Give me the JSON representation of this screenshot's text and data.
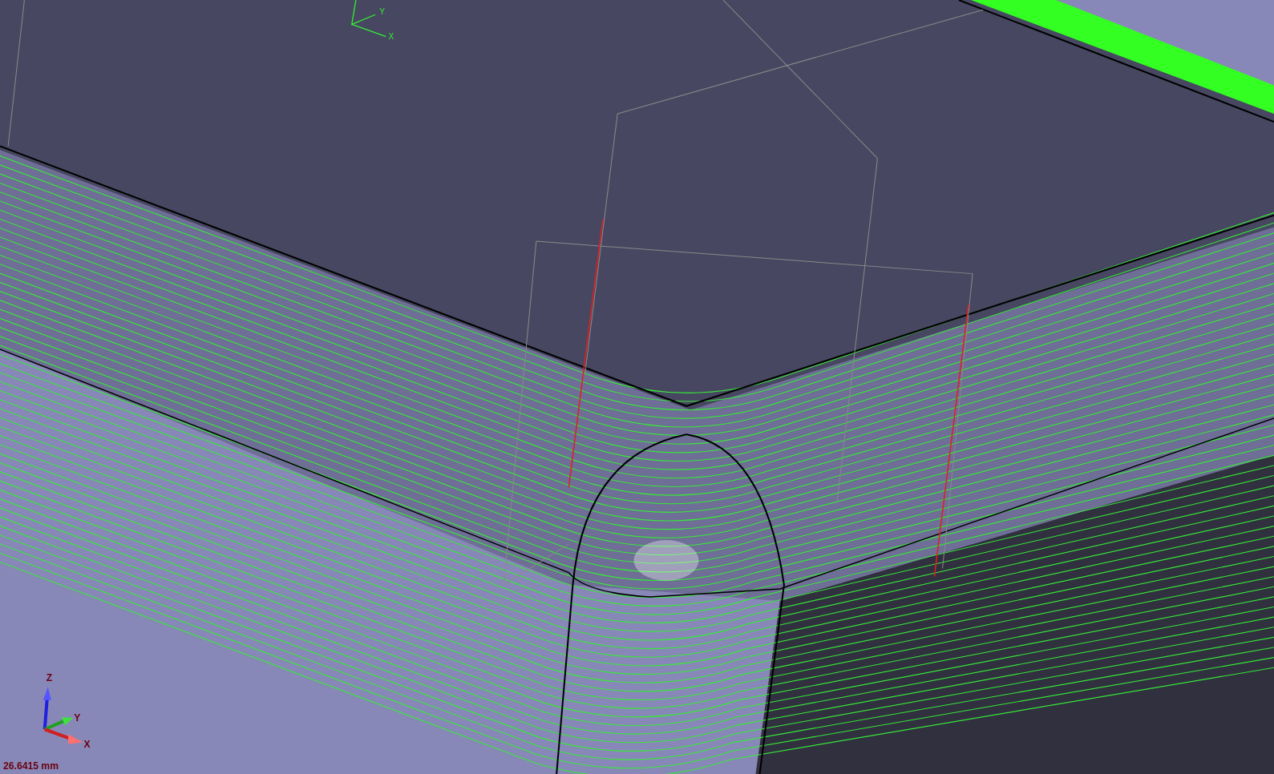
{
  "workplane_triad": {
    "y_label": "Y",
    "x_label": "X"
  },
  "view_triad": {
    "z_label": "Z",
    "y_label": "Y",
    "x_label": "X"
  },
  "scale_readout": "26.6415 mm"
}
